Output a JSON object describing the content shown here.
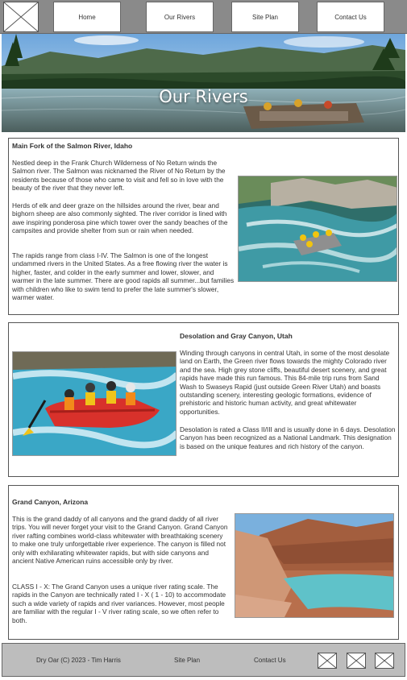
{
  "nav": {
    "logo_icon": "placeholder-x-icon",
    "items": [
      {
        "label": "Home"
      },
      {
        "label": "Our Rivers"
      },
      {
        "label": "Site Plan"
      },
      {
        "label": "Contact Us"
      }
    ]
  },
  "hero": {
    "title": "Our Rivers"
  },
  "sections": [
    {
      "title": "Main Fork of the Salmon River, Idaho",
      "paragraphs": [
        "Nestled deep in the Frank Church Wilderness of No Return winds the Salmon river. The Salmon was nicknamed the River of No Return by the residents because of those who came to visit and fell so in love with the beauty of the river that they never left.",
        "Herds of elk and deer graze on the hillsides around the river, bear and bighorn sheep are also commonly sighted. The river corridor is lined with awe inspiring ponderosa pine which tower over the sandy beaches of the campsites and provide shelter from sun or rain when needed.",
        "The rapids range from class I-IV. The Salmon is one of the longest undammed rivers in the United States. As a free flowing river the water is higher, faster, and colder in the early summer and lower, slower, and warmer in the late summer. There are good rapids all summer...but families with children who like to swim tend to prefer the late summer's slower, warmer water."
      ]
    },
    {
      "title": "Desolation and Gray Canyon, Utah",
      "paragraphs": [
        "Winding through canyons in central Utah, in some of the most desolate land on Earth, the Green river flows towards the mighty Colorado river and the sea. High grey stone cliffs, beautiful desert scenery, and great rapids have made this run famous. This 84-mile trip runs from Sand Wash to Swaseys Rapid (just outside Green River Utah) and boasts outstanding scenery, interesting geologic formations, evidence of prehistoric and historic human activity, and great whitewater opportunities.",
        "Desolation is rated a Class II/III and is usually done in 6 days. Desolation Canyon has been recognized as a National Landmark. This designation is based on the unique features and rich history of the canyon."
      ]
    },
    {
      "title": "Grand Canyon, Arizona",
      "paragraphs": [
        "This is the grand daddy of all canyons and the grand daddy of all river trips. You will never forget your visit to the Grand Canyon. Grand Canyon river rafting combines world-class whitewater with breathtaking scenery to make one truly unforgettable river experience. The canyon is filled not only with exhilarating whitewater rapids, but with side canyons and ancient Native American ruins accessible only by river.",
        "CLASS I - X: The Grand Canyon uses a unique river rating scale. The rapids in the Canyon are technically rated I - X ( 1 - 10) to accommodate such a wide variety of rapids and river variances. However, most people are familiar with the regular I - V river rating scale, so we often refer to both."
      ]
    }
  ],
  "footer": {
    "copyright": "Dry Oar (C) 2023 - Tim Harris",
    "site_plan": "Site Plan",
    "contact": "Contact Us",
    "social_icons": [
      "placeholder-x-icon",
      "placeholder-x-icon",
      "placeholder-x-icon"
    ]
  }
}
